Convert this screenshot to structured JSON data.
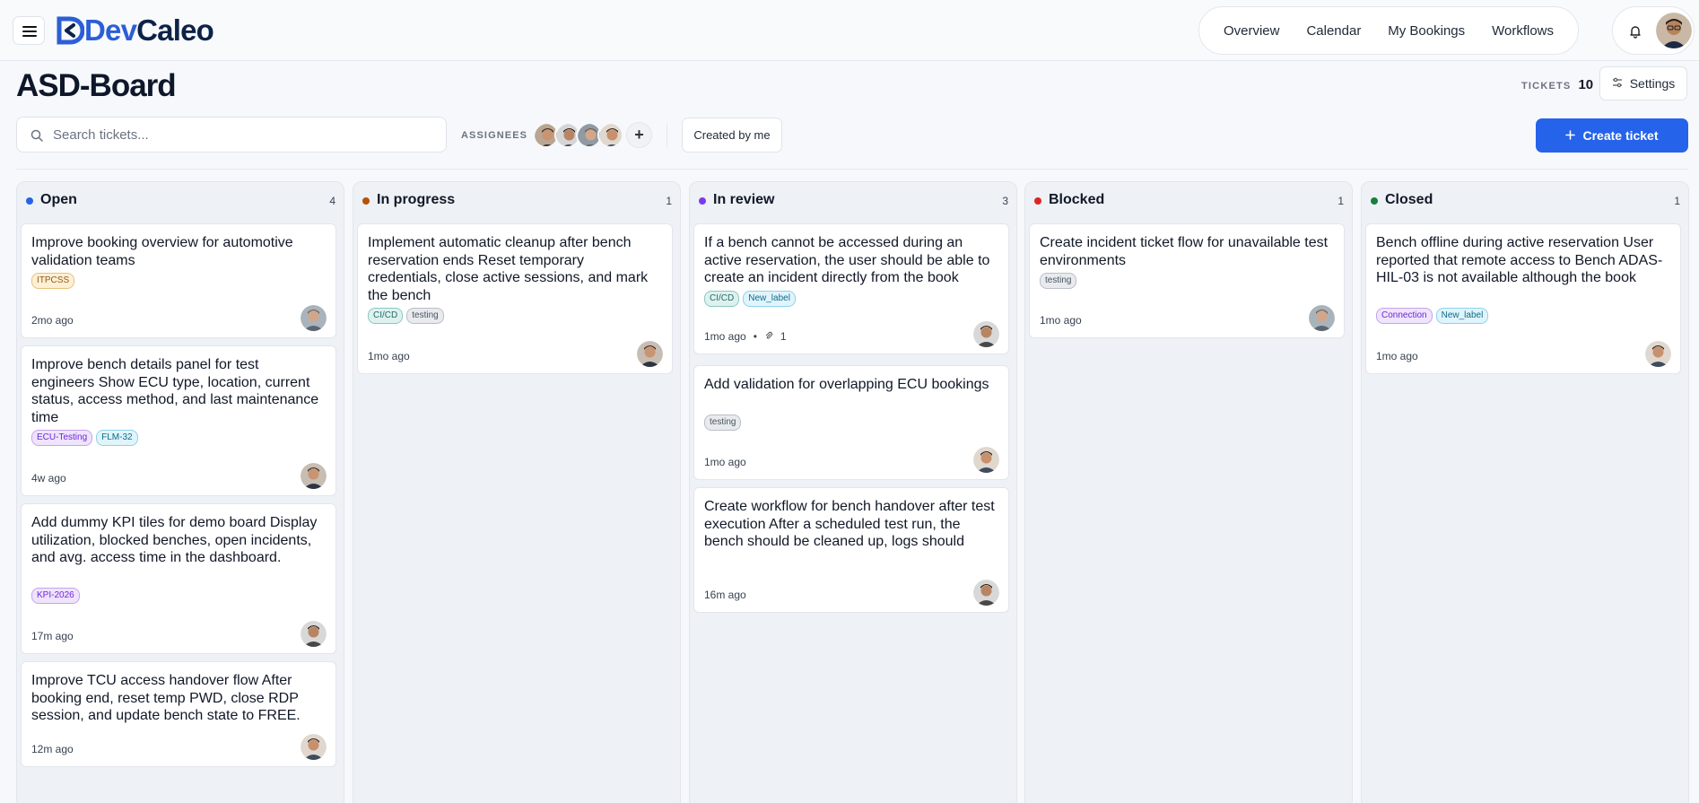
{
  "app": {
    "logo_prefix": "Dev",
    "logo_suffix": "Caleo"
  },
  "nav": [
    "Overview",
    "Calendar",
    "My Bookings",
    "Workflows"
  ],
  "page": {
    "title": "ASD-Board",
    "tickets_label": "TICKETS",
    "tickets_count": "10",
    "settings_label": "Settings"
  },
  "toolbar": {
    "search_placeholder": "Search tickets...",
    "assignees_label": "ASSIGNEES",
    "add_assignee": "+",
    "created_by_me": "Created by me",
    "create_ticket": "Create ticket"
  },
  "colors": {
    "accent": "#2563eb",
    "open": "#2563eb",
    "in_progress": "#b45309",
    "in_review": "#7c3aed",
    "blocked": "#dc2626",
    "closed": "#15803d"
  },
  "columns": [
    {
      "title": "Open",
      "count": "4",
      "dot": "#2563eb",
      "cards": [
        {
          "title": "Improve booking overview for automotive validation teams",
          "tags": [
            {
              "label": "ITPCSS",
              "kind": "amber"
            }
          ],
          "time": "2mo ago",
          "attachments": null
        },
        {
          "title": "Improve bench details panel for test engineers Show ECU type, location, current status, access method, and last maintenance time",
          "tags": [
            {
              "label": "ECU-Testing",
              "kind": "purple"
            },
            {
              "label": "FLM-32",
              "kind": "cyan"
            }
          ],
          "time": "4w ago",
          "attachments": null
        },
        {
          "title": "Add dummy KPI tiles for demo board Display utilization, blocked benches, open incidents, and avg. access time in the dashboard.",
          "tags": [
            {
              "label": "KPI-2026",
              "kind": "purple"
            }
          ],
          "time": "17m ago",
          "attachments": null
        },
        {
          "title": "Improve TCU access handover flow After booking end, reset temp PWD, close RDP session, and update bench state to FREE.",
          "tags": [],
          "time": "12m ago",
          "attachments": null
        }
      ]
    },
    {
      "title": "In progress",
      "count": "1",
      "dot": "#b45309",
      "cards": [
        {
          "title": "Implement automatic cleanup after bench reservation ends Reset temporary credentials, close active sessions, and mark the bench",
          "tags": [
            {
              "label": "CI/CD",
              "kind": "teal"
            },
            {
              "label": "testing",
              "kind": "gray"
            }
          ],
          "time": "1mo ago",
          "attachments": null
        }
      ]
    },
    {
      "title": "In review",
      "count": "3",
      "dot": "#7c3aed",
      "cards": [
        {
          "title": "If a bench cannot be accessed during an active reservation, the user should be able to create an incident directly from the book",
          "tags": [
            {
              "label": "CI/CD",
              "kind": "teal"
            },
            {
              "label": "New_label",
              "kind": "cyan"
            }
          ],
          "time": "1mo ago",
          "attachments": "1"
        },
        {
          "title": "Add validation for overlapping ECU bookings",
          "tags": [
            {
              "label": "testing",
              "kind": "gray"
            }
          ],
          "time": "1mo ago",
          "attachments": null
        },
        {
          "title": "Create workflow for bench handover after test execution After a scheduled test run, the bench should be cleaned up, logs should",
          "tags": [],
          "time": "16m ago",
          "attachments": null
        }
      ]
    },
    {
      "title": "Blocked",
      "count": "1",
      "dot": "#dc2626",
      "cards": [
        {
          "title": "Create incident ticket flow for unavailable test environments",
          "tags": [
            {
              "label": "testing",
              "kind": "gray"
            }
          ],
          "time": "1mo ago",
          "attachments": null
        }
      ]
    },
    {
      "title": "Closed",
      "count": "1",
      "dot": "#15803d",
      "cards": [
        {
          "title": "Bench offline during active reservation User reported that remote access to Bench ADAS-HIL-03 is not available although the book",
          "tags": [
            {
              "label": "Connection",
              "kind": "purple"
            },
            {
              "label": "New_label",
              "kind": "cyan"
            }
          ],
          "time": "1mo ago",
          "attachments": null
        }
      ]
    }
  ]
}
